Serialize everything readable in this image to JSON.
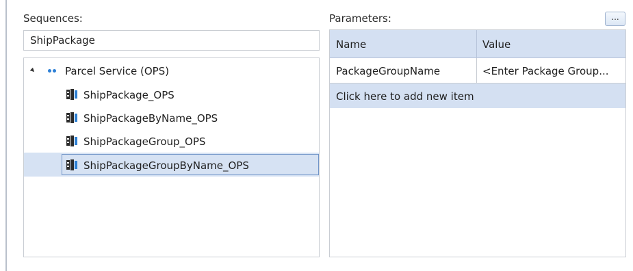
{
  "sequences": {
    "label": "Sequences:",
    "search_value": "ShipPackage",
    "tree": {
      "parent_label": "Parcel Service (OPS)",
      "children": [
        "ShipPackage_OPS",
        "ShipPackageByName_OPS",
        "ShipPackageGroup_OPS",
        "ShipPackageGroupByName_OPS"
      ],
      "selected": "ShipPackageGroupByName_OPS"
    }
  },
  "parameters": {
    "label": "Parameters:",
    "ellipsis_label": "...",
    "columns": [
      "Name",
      "Value"
    ],
    "rows": [
      {
        "name": "PackageGroupName",
        "value": "<Enter Package Group..."
      }
    ],
    "add_row_label": "Click here to add new item"
  },
  "colors": {
    "accent_blue": "#2c7fd6",
    "header_bg": "#d4e0f2",
    "selection_bg": "#d6e2f3",
    "selection_border": "#6f93c7"
  },
  "icons": {
    "tree_expand": "expand-triangle-icon",
    "tree_parent": "service-dots-icon",
    "tree_child": "sequence-icon"
  }
}
